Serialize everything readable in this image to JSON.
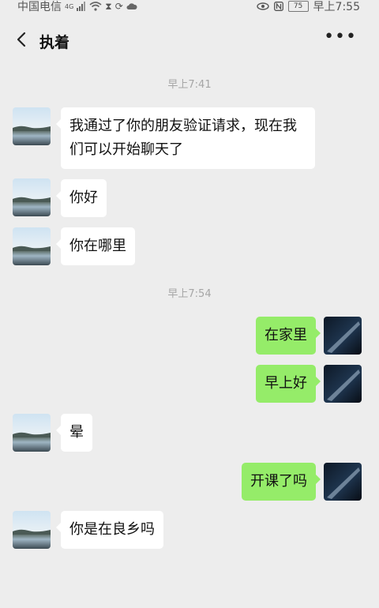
{
  "status_bar": {
    "carrier": "中国电信",
    "network": "4G",
    "battery": "75",
    "time": "早上7:55"
  },
  "header": {
    "title": "执着"
  },
  "timestamps": [
    "早上7:41",
    "早上7:54"
  ],
  "messages": [
    {
      "side": "left",
      "text": "我通过了你的朋友验证请求，现在我们可以开始聊天了"
    },
    {
      "side": "left",
      "text": "你好"
    },
    {
      "side": "left",
      "text": "你在哪里"
    },
    {
      "side": "right",
      "text": "在家里"
    },
    {
      "side": "right",
      "text": "早上好"
    },
    {
      "side": "left",
      "text": "晕"
    },
    {
      "side": "right",
      "text": "开课了吗"
    },
    {
      "side": "left",
      "text": "你是在良乡吗"
    }
  ],
  "colors": {
    "background": "#ededed",
    "self_bubble": "#95ec69",
    "other_bubble": "#ffffff"
  },
  "icons": [
    "back-arrow-icon",
    "more-icon",
    "wifi-icon",
    "signal-icon",
    "nfc-icon",
    "eye-icon",
    "cloud-icon",
    "alarm-icon"
  ]
}
